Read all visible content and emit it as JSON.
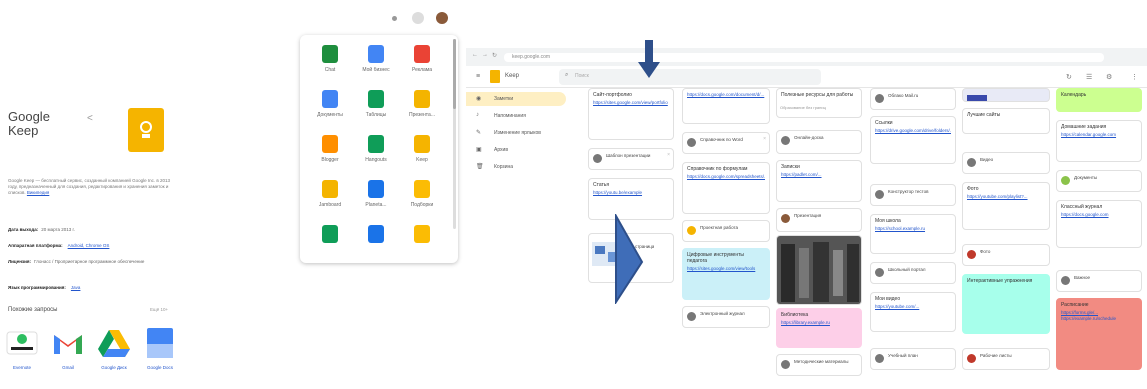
{
  "knowledge_panel": {
    "title": "Google Keep",
    "share_icon": "share-icon",
    "logo_color": "#f5b400",
    "description": "Google Keep — бесплатный сервис, созданный компанией Google Inc. в 2013 году, предназначенный для создания, редактирования и хранения заметок и списков.",
    "description_link": "Википедия",
    "facts": [
      {
        "label": "Дата выхода:",
        "value": "20 марта 2013 г."
      },
      {
        "label": "Аппаратная платформа:",
        "value": "Android, Chrome OS"
      },
      {
        "label": "Лицензия:",
        "value": "Глонасс / Проприетарное программное обеспечение"
      },
      {
        "label": "Язык программирования:",
        "value": "Java"
      }
    ],
    "related_title": "Похожие запросы",
    "related_more": "Ещё 10+",
    "related": [
      {
        "label": "Evernote",
        "icon": "evernote-icon"
      },
      {
        "label": "Gmail",
        "icon": "gmail-icon"
      },
      {
        "label": "Google Диск",
        "icon": "google-drive-icon"
      },
      {
        "label": "Google Docs",
        "icon": "google-docs-icon"
      }
    ]
  },
  "launcher": {
    "apps": [
      {
        "label": "Chat",
        "icon": "chat-icon",
        "color": "#1e8e3e"
      },
      {
        "label": "Мой бизнес",
        "icon": "my-business-icon",
        "color": "#4285f4"
      },
      {
        "label": "Реклама",
        "icon": "ads-icon",
        "color": "#ea4335"
      },
      {
        "label": "Документы",
        "icon": "docs-icon",
        "color": "#4285f4"
      },
      {
        "label": "Таблицы",
        "icon": "sheets-icon",
        "color": "#0f9d58"
      },
      {
        "label": "Презента...",
        "icon": "slides-icon",
        "color": "#f4b400"
      },
      {
        "label": "Blogger",
        "icon": "blogger-icon",
        "color": "#ff8f00"
      },
      {
        "label": "Hangouts",
        "icon": "hangouts-icon",
        "color": "#0f9d58"
      },
      {
        "label": "Keep",
        "icon": "keep-icon",
        "color": "#f5b400"
      },
      {
        "label": "Jamboard",
        "icon": "jamboard-icon",
        "color": "#f4b400"
      },
      {
        "label": "Planeta...",
        "icon": "earth-icon",
        "color": "#1a73e8"
      },
      {
        "label": "Подборки",
        "icon": "collections-icon",
        "color": "#fbbc04"
      },
      {
        "label": "",
        "icon": "sites-icon",
        "color": "#0f9d58"
      },
      {
        "label": "",
        "icon": "contacts-icon",
        "color": "#1a73e8"
      },
      {
        "label": "",
        "icon": "drive-icon",
        "color": "#fbbc04"
      }
    ]
  },
  "browser": {
    "url": "keep.google.com",
    "app_name": "Keep",
    "search_placeholder": "Поиск",
    "menu_icon": "menu-icon"
  },
  "sidebar": {
    "items": [
      {
        "label": "Заметки",
        "icon": "bulb-icon",
        "active": true
      },
      {
        "label": "Напоминания",
        "icon": "bell-icon",
        "active": false
      },
      {
        "label": "Изменение ярлыков",
        "icon": "pencil-icon",
        "active": false
      },
      {
        "label": "Архив",
        "icon": "archive-icon",
        "active": false
      },
      {
        "label": "Корзина",
        "icon": "trash-icon",
        "active": false
      }
    ]
  },
  "notes": {
    "c1_n1_title": "Сайт-портфолио",
    "c1_n1_link": "https://sites.google.com/view/portfolio",
    "c1_n2_title": "Шаблон презентации",
    "c1_n3_title": "Статья",
    "c1_n3_link": "https://youtu.be/example",
    "c1_n4_title": "Моя страница",
    "c2_n1_link": "https://docs.google.com/document/d/...",
    "c2_n2_title": "Справочник по Word",
    "c2_n3_title": "Справочник по формулам",
    "c2_n3_link": "https://docs.google.com/spreadsheets/...",
    "c2_n4_title": "Проектная работа",
    "c2_n5_title": "Цифровые инструменты педагога",
    "c2_n5_link": "https://sites.google.com/view/tools",
    "c2_n6_title": "Электронный журнал",
    "c3_n1_title": "Полезные ресурсы для работы",
    "c3_n2_title": "Образование без границ",
    "c3_n3_title": "Онлайн-доска",
    "c3_n4_title": "Google",
    "c3_n5_title": "Записки",
    "c3_n5_link": "https://padlet.com/...",
    "c3_n6_title": "Презентация",
    "c3_n7_title": "Библиотека",
    "c3_n7_link": "https://library.example.ru",
    "c3_n8_title": "Методические материалы",
    "c4_n1_title": "Облако Mail.ru",
    "c4_n2_title": "Ссылки",
    "c4_n2_link": "https://drive.google.com/drive/folders/...",
    "c4_n3_title": "Конструктор тестов",
    "c4_n4_title": "Моя школа",
    "c4_n4_link": "https://school.example.ru",
    "c4_n5_title": "Школьный портал",
    "c4_n6_title": "Мои видео",
    "c4_n6_link": "https://youtube.com/...",
    "c4_n7_title": "Учебный план",
    "c5_n1_title": "Лучшие сайты",
    "c5_n2_title": "Видео",
    "c5_n2_link": "https://youtube.com/playlist?...",
    "c5_n3_title": "Фото",
    "c5_n4_title": "Интерактивные упражнения",
    "c5_n5_title": "Рабочие листы",
    "c6_n1_title": "Календарь",
    "c6_n1_link": "https://calendar.google.com",
    "c6_n2_title": "Домашние задания",
    "c6_n3_title": "Документы",
    "c6_n3_link": "https://docs.google.com",
    "c6_n4_title": "Классный журнал",
    "c6_n5_title": "Важное",
    "c6_n5_link": "https://forms.gle/...",
    "c6_n6_title": "Расписание",
    "c6_n6_link": "https://example.ru/schedule"
  }
}
